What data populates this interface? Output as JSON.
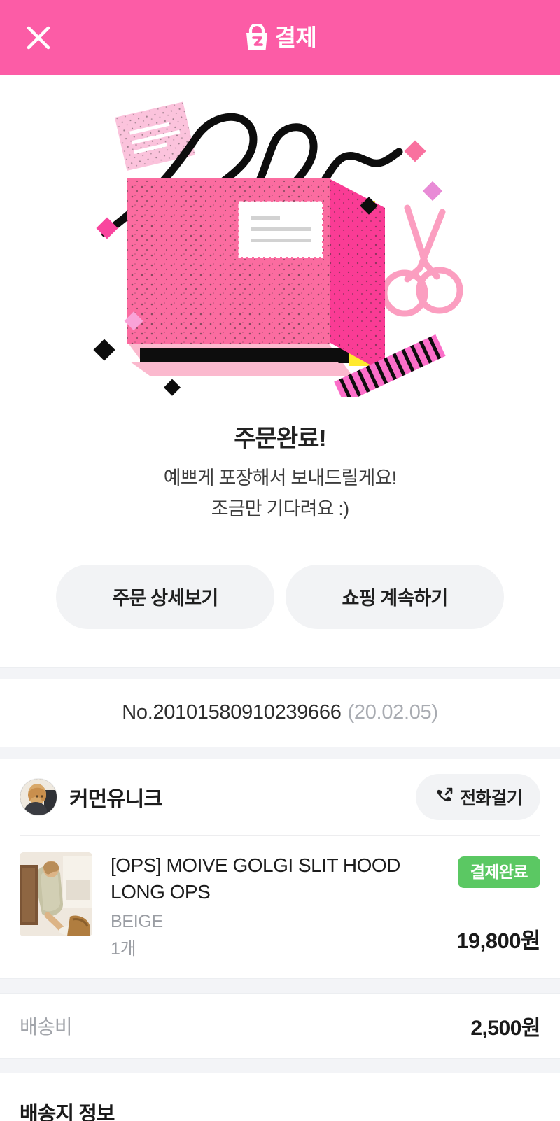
{
  "header": {
    "close_icon": "close-icon",
    "brand_icon": "shopping-bag-z-icon",
    "title": "결제",
    "bg_color": "#FC5CA6"
  },
  "hero": {
    "illustration_name": "pink-package-envelope-illustration",
    "alt": "분홍색 택배 상자와 리본, 가위, 마스킹테이프 일러스트"
  },
  "messages": {
    "title": "주문완료!",
    "line1": "예쁘게 포장해서 보내드릴게요!",
    "line2": "조금만 기다려요 :)"
  },
  "actions": {
    "order_detail_label": "주문 상세보기",
    "continue_shopping_label": "쇼핑 계속하기"
  },
  "order": {
    "number": "No.20101580910239666",
    "date": "(20.02.05)"
  },
  "shop": {
    "name": "커먼유니크",
    "avatar_name": "shop-avatar",
    "call_label": "전화걸기",
    "call_icon": "phone-outgoing-icon"
  },
  "product": {
    "thumbnail_name": "product-thumbnail",
    "name": "[OPS] MOIVE GOLGI SLIT HOOD LONG OPS",
    "option": "BEIGE",
    "quantity": "1개",
    "price": "19,800원",
    "status": "결제완료",
    "status_color": "#5BC863"
  },
  "shipping": {
    "label": "배송비",
    "value": "2,500원"
  },
  "delivery": {
    "section_title": "배송지 정보"
  }
}
